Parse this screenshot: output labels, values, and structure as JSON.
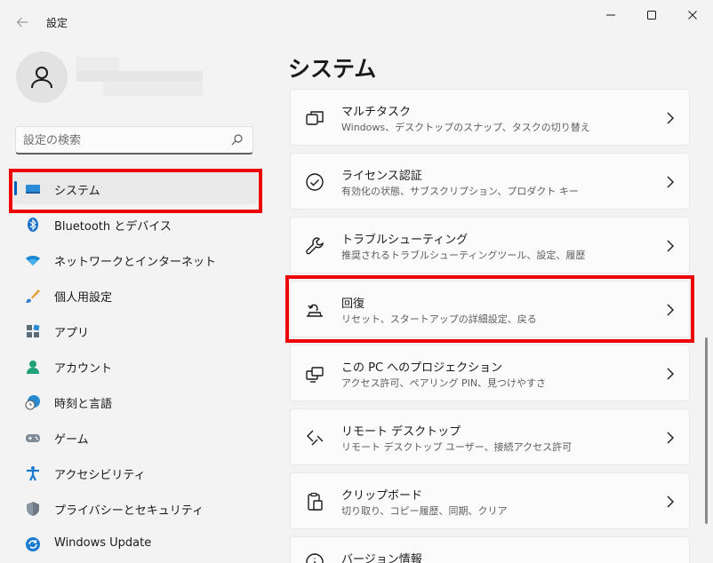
{
  "window": {
    "title": "設定",
    "back_icon": "arrow-left-icon",
    "minimize_icon": "minimize-icon",
    "maximize_icon": "maximize-icon",
    "close_icon": "close-icon"
  },
  "user": {
    "avatar_icon": "person-icon"
  },
  "search": {
    "placeholder": "設定の検索",
    "value": "",
    "icon": "search-icon"
  },
  "sidebar": {
    "items": [
      {
        "label": "システム",
        "icon": "display-icon",
        "active": true
      },
      {
        "label": "Bluetooth とデバイス",
        "icon": "bluetooth-icon"
      },
      {
        "label": "ネットワークとインターネット",
        "icon": "wifi-icon"
      },
      {
        "label": "個人用設定",
        "icon": "brush-icon"
      },
      {
        "label": "アプリ",
        "icon": "apps-icon"
      },
      {
        "label": "アカウント",
        "icon": "account-icon"
      },
      {
        "label": "時刻と言語",
        "icon": "globe-clock-icon"
      },
      {
        "label": "ゲーム",
        "icon": "gamepad-icon"
      },
      {
        "label": "アクセシビリティ",
        "icon": "accessibility-icon"
      },
      {
        "label": "プライバシーとセキュリティ",
        "icon": "shield-icon"
      },
      {
        "label": "Windows Update",
        "icon": "update-icon"
      }
    ]
  },
  "main": {
    "title": "システム",
    "cards": [
      {
        "title": "マルチタスク",
        "subtitle": "Windows、デスクトップのスナップ、タスクの切り替え",
        "icon": "multitask-icon"
      },
      {
        "title": "ライセンス認証",
        "subtitle": "有効化の状態、サブスクリプション、プロダクト キー",
        "icon": "activation-check-icon"
      },
      {
        "title": "トラブルシューティング",
        "subtitle": "推奨されるトラブルシューティングツール、設定、履歴",
        "icon": "wrench-icon"
      },
      {
        "title": "回復",
        "subtitle": "リセット、スタートアップの詳細設定、戻る",
        "icon": "recovery-icon"
      },
      {
        "title": "この PC へのプロジェクション",
        "subtitle": "アクセス許可、ペアリング PIN、見つけやすさ",
        "icon": "projection-icon"
      },
      {
        "title": "リモート デスクトップ",
        "subtitle": "リモート デスクトップ ユーザー、接続アクセス許可",
        "icon": "remote-desktop-icon"
      },
      {
        "title": "クリップボード",
        "subtitle": "切り取り、コピー履歴、同期、クリア",
        "icon": "clipboard-icon"
      },
      {
        "title": "バージョン情報",
        "subtitle": "",
        "icon": "info-icon"
      }
    ]
  },
  "colors": {
    "accent": "#005fb8",
    "highlight_box": "#ee0000"
  }
}
